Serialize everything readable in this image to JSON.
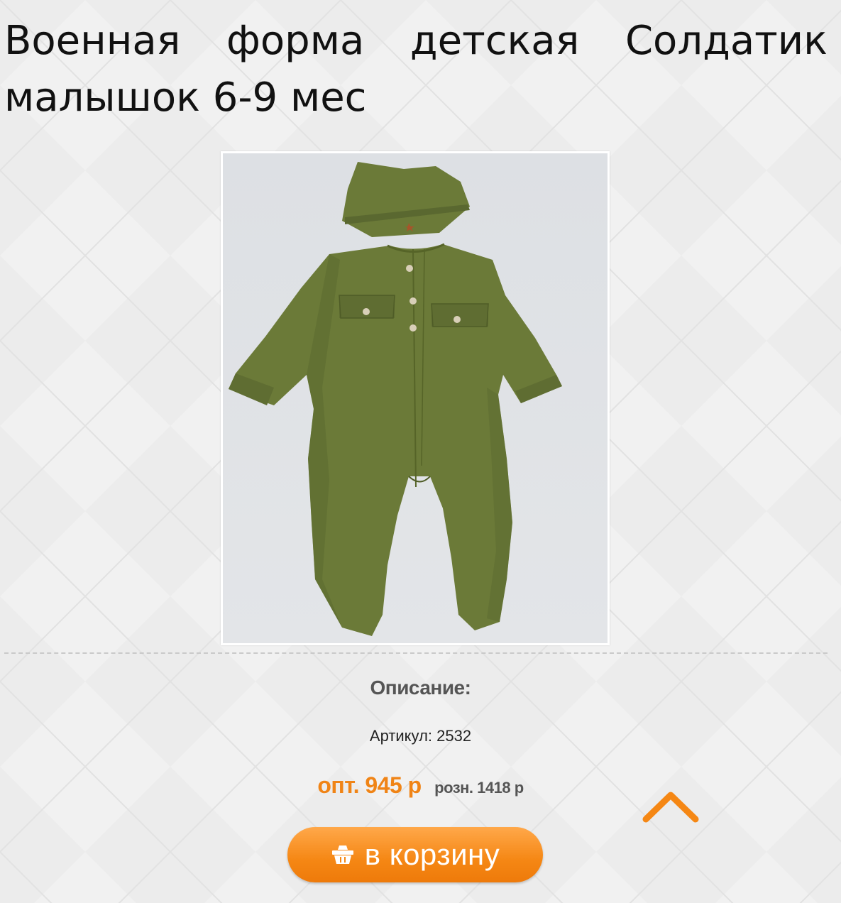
{
  "product": {
    "title": "Военная форма детская Солдатик малышок 6-9 мес",
    "image_alt": "Военная форма детская Солдатик малышок 6-9 мес"
  },
  "details": {
    "description_heading": "Описание:",
    "sku_label": "Артикул:",
    "sku_value": "2532"
  },
  "pricing": {
    "wholesale": "опт. 945 р",
    "retail": "розн. 1418 р"
  },
  "actions": {
    "cart_button_label": "в корзину",
    "cart_icon": "basket-icon",
    "scroll_top_icon": "chevron-up-icon"
  },
  "colors": {
    "accent": "#f58714",
    "price": "#f08416",
    "uniform": "#6b7a38"
  }
}
